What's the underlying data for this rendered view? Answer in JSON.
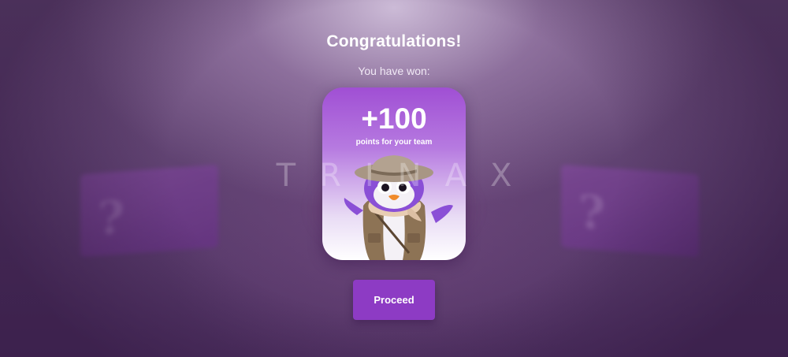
{
  "dialog": {
    "title": "Congratulations!",
    "subtitle": "You have won:"
  },
  "reward": {
    "points": "+100",
    "caption": "points for your team",
    "mascot_icon": "penguin-explorer-icon"
  },
  "watermark": {
    "text": "TRINAX"
  },
  "background": {
    "box_icon": "question-mark-icon",
    "box_symbol": "?"
  },
  "actions": {
    "proceed_label": "Proceed"
  },
  "colors": {
    "accent": "#8d3bc4",
    "card_top": "#a04fd4",
    "background": "#5d3f6f"
  }
}
